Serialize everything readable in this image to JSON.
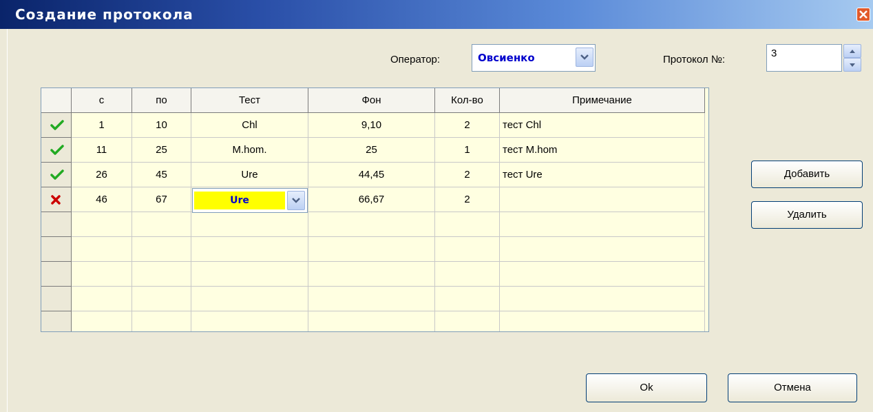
{
  "window": {
    "title": "Создание протокола"
  },
  "header": {
    "operator_label": "Оператор:",
    "operator_value": "Овсиенко",
    "protocol_label": "Протокол №:",
    "protocol_value": "3"
  },
  "grid": {
    "columns": [
      "с",
      "по",
      "Тест",
      "Фон",
      "Кол-во",
      "Примечание"
    ],
    "rows": [
      {
        "status": "check-icon",
        "c1": "1",
        "c2": "10",
        "c3": "Chl",
        "c4": "9,10",
        "c5": "2",
        "c6": "тест Chl"
      },
      {
        "status": "check-icon",
        "c1": "11",
        "c2": "25",
        "c3": "M.hom.",
        "c4": "25",
        "c5": "1",
        "c6": "тест M.hom"
      },
      {
        "status": "check-icon",
        "c1": "26",
        "c2": "45",
        "c3": "Ure",
        "c4": "44,45",
        "c5": "2",
        "c6": "тест Ure"
      },
      {
        "status": "cross-icon",
        "c1": "46",
        "c2": "67",
        "c3": "Ure",
        "c4": "66,67",
        "c5": "2",
        "c6": ""
      }
    ]
  },
  "buttons": {
    "add": "Добавить",
    "delete": "Удалить",
    "ok": "Ok",
    "cancel": "Отмена"
  },
  "colors": {
    "check": "#22aa22",
    "cross": "#cc0000",
    "grid_bg": "#ffffe1",
    "edit_highlight": "#ffff00",
    "value_text": "#0000cc"
  }
}
